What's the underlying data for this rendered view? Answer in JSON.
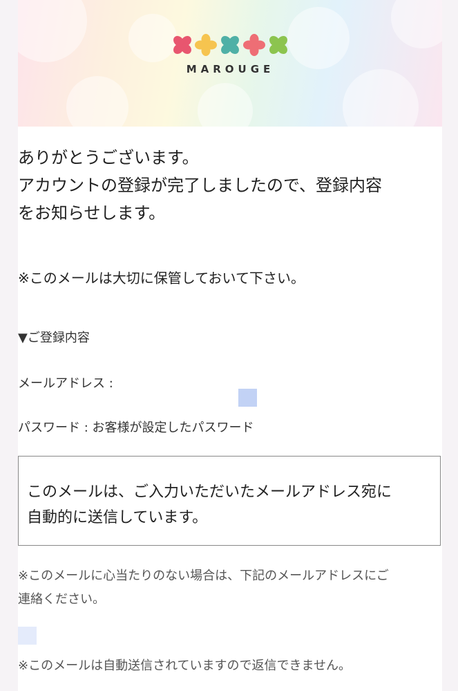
{
  "header": {
    "brand": "MAROUGE"
  },
  "message": {
    "thanks_line1": "ありがとうございます。",
    "thanks_line2": "アカウントの登録が完了しましたので、登録内容",
    "thanks_line3": "をお知らせします。",
    "keep_note": "※このメールは大切に保管しておいて下さい。"
  },
  "registration": {
    "heading": "▼ご登録内容",
    "email_label": "メールアドレス :",
    "password_line": "パスワード : お客様が設定したパスワード"
  },
  "notice_box": {
    "line1": "このメールは、ご入力いただいたメールアドレス宛に",
    "line2": "自動的に送信しています。"
  },
  "footer": {
    "contact_line1": "※このメールに心当たりのない場合は、下記のメールアドレスにご",
    "contact_line2": "連絡ください。",
    "noreply_note": "※このメールは自動送信されていますので返信できません。"
  },
  "colors": {
    "petal_pink": "#e8566f",
    "petal_yellow": "#f6c44f",
    "petal_teal": "#4fb0a6",
    "petal_coral": "#ee6e75",
    "petal_green": "#8cc44f"
  }
}
